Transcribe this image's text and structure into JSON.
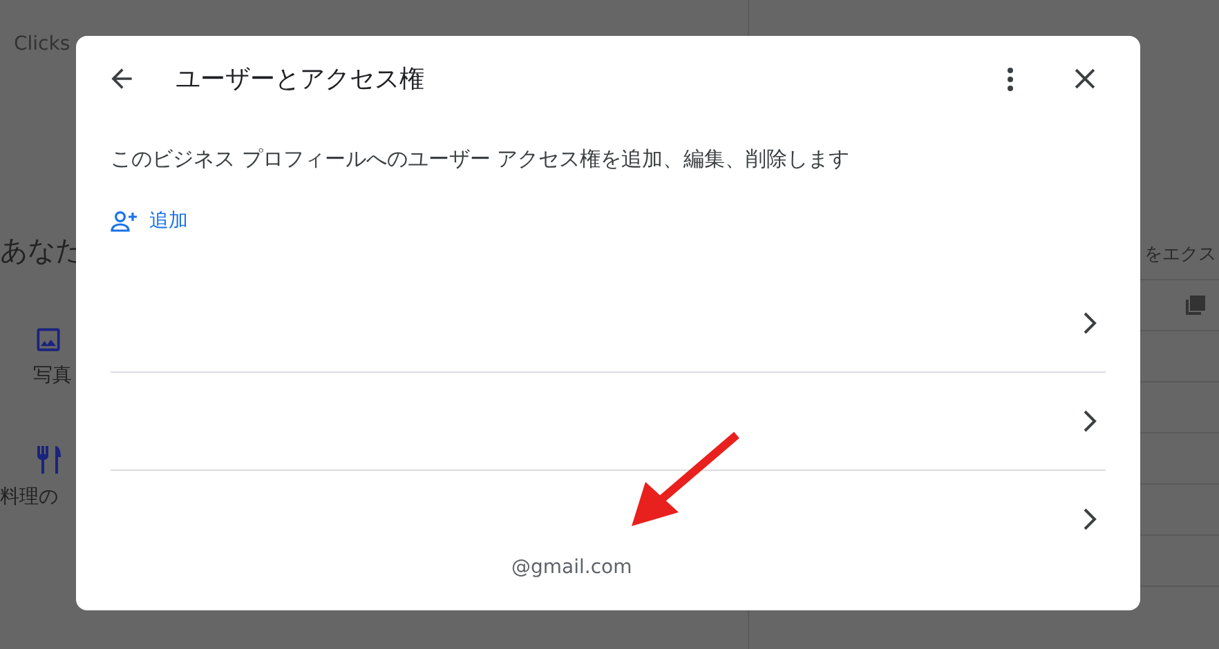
{
  "background": {
    "breadcrumb": "Clicks",
    "heading": "あなた",
    "actions": [
      {
        "kind": "photo",
        "label": "写真"
      },
      {
        "kind": "menu",
        "label": "料理の"
      }
    ],
    "export_label": "をエクス"
  },
  "dialog": {
    "title": "ユーザーとアクセス権",
    "description": "このビジネス プロフィールへのユーザー アクセス権を追加、編集、削除します",
    "add_label": "追加",
    "users": [
      {
        "kind": "user"
      },
      {
        "kind": "user"
      },
      {
        "kind": "user",
        "email": "@gmail.com"
      }
    ]
  },
  "annotation": {
    "kind": "arrow",
    "color": "#e8201e"
  }
}
